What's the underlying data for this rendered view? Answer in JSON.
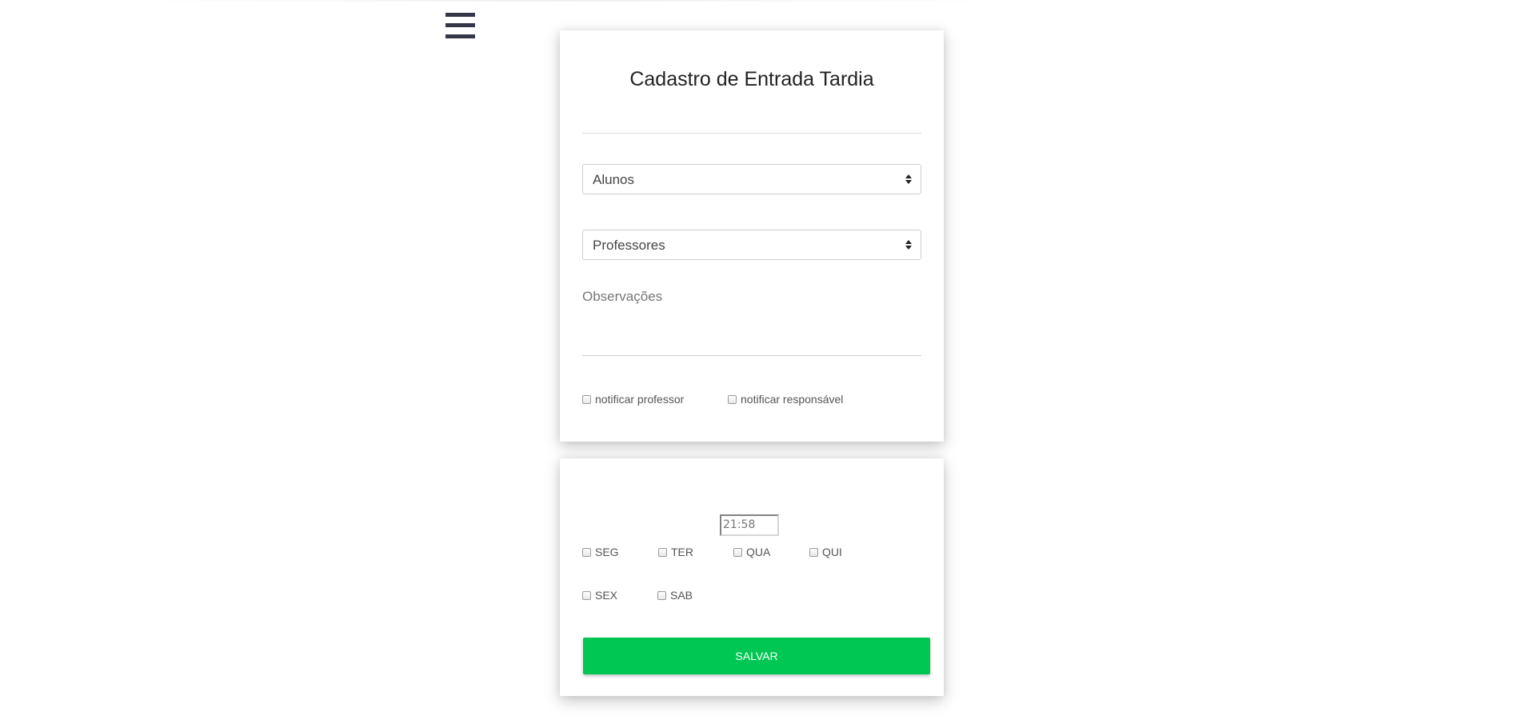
{
  "form": {
    "title": "Cadastro de Entrada Tardia",
    "students_select": "Alunos",
    "teachers_select": "Professores",
    "observations_label": "Observações",
    "notify_teacher": "notificar professor",
    "notify_guardian": "notificar responsável"
  },
  "schedule": {
    "time_value": "21:58",
    "days": [
      "SEG",
      "TER",
      "QUA",
      "QUI",
      "SEX",
      "SAB"
    ],
    "save_label": "SALVAR"
  },
  "colors": {
    "save_button": "#00c753",
    "menu_icon": "#343747"
  }
}
